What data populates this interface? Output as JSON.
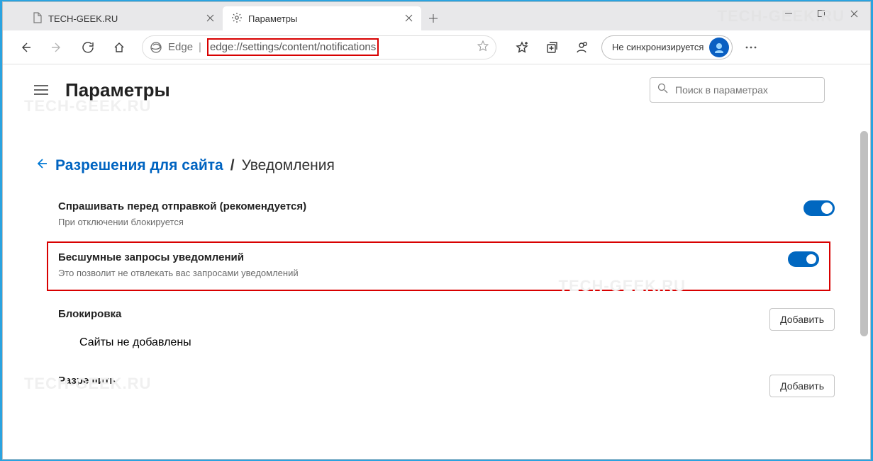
{
  "tabs": {
    "tab1": "TECH-GEEK.RU",
    "tab2": "Параметры"
  },
  "address": {
    "label": "Edge",
    "url_plain": "edge://settings/content/notifications"
  },
  "profile": {
    "label": "Не синхронизируется"
  },
  "page": {
    "title": "Параметры",
    "search_placeholder": "Поиск в параметрах"
  },
  "crumb": {
    "link": "Разрешения для сайта",
    "sep": "/",
    "current": "Уведомления"
  },
  "s1": {
    "t1": "Спрашивать перед отправкой (рекомендуется)",
    "t2": "При отключении блокируется"
  },
  "s2": {
    "t1": "Бесшумные запросы уведомлений",
    "t2": "Это позволит не отвлекать вас запросами уведомлений"
  },
  "s3": {
    "t1": "Блокировка",
    "sub": "Сайты не добавлены",
    "btn": "Добавить"
  },
  "s4": {
    "t1": "Разрешить",
    "btn": "Добавить"
  },
  "watermark": "TECH-GEEK.RU"
}
